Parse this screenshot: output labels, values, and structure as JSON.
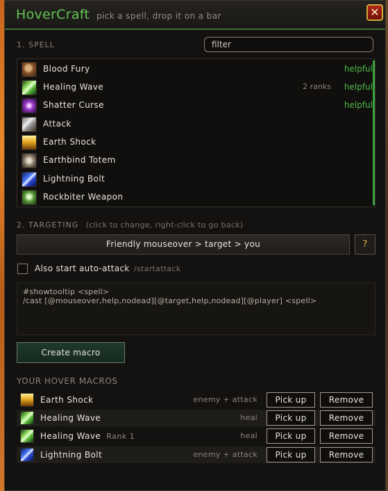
{
  "window": {
    "title": "HoverCraft",
    "subtitle": "pick a spell, drop it on a bar",
    "close_label": "✕"
  },
  "spell_section": {
    "label": "1. SPELL",
    "filter_placeholder": "filter",
    "spells": [
      {
        "name": "Blood Fury",
        "rank": "",
        "tag": "helpful",
        "icon": "blood-fury-icon"
      },
      {
        "name": "Healing Wave",
        "rank": "2 ranks",
        "tag": "helpful",
        "icon": "healing-wave-icon"
      },
      {
        "name": "Shatter Curse",
        "rank": "",
        "tag": "helpful",
        "icon": "shatter-curse-icon"
      },
      {
        "name": "Attack",
        "rank": "",
        "tag": "",
        "icon": "attack-icon"
      },
      {
        "name": "Earth Shock",
        "rank": "",
        "tag": "",
        "icon": "earth-shock-icon"
      },
      {
        "name": "Earthbind Totem",
        "rank": "",
        "tag": "",
        "icon": "earthbind-totem-icon"
      },
      {
        "name": "Lightning Bolt",
        "rank": "",
        "tag": "",
        "icon": "lightning-bolt-icon"
      },
      {
        "name": "Rockbiter Weapon",
        "rank": "",
        "tag": "",
        "icon": "rockbiter-weapon-icon"
      }
    ]
  },
  "targeting": {
    "label": "2. TARGETING",
    "hint": "(click to change, right-click to go back)",
    "button_label": "Friendly mouseover > target > you",
    "help_label": "?"
  },
  "auto_attack": {
    "label": "Also start auto-attack",
    "hint": "/startattack",
    "checked": false
  },
  "macro_text": {
    "line1": "#showtooltip <spell>",
    "line2": "/cast [@mouseover,help,nodead][@target,help,nodead][@player] <spell>"
  },
  "create_button_label": "Create macro",
  "hover_macros": {
    "heading": "YOUR HOVER MACROS",
    "pick_label": "Pick up",
    "remove_label": "Remove",
    "items": [
      {
        "name": "Earth Shock",
        "rank": "",
        "desc": "enemy + attack",
        "icon": "earth-shock-icon"
      },
      {
        "name": "Healing Wave",
        "rank": "",
        "desc": "heal",
        "icon": "healing-wave-icon"
      },
      {
        "name": "Healing Wave",
        "rank": "Rank 1",
        "desc": "heal",
        "icon": "healing-wave-icon"
      },
      {
        "name": "Lightning Bolt",
        "rank": "",
        "desc": "enemy + attack",
        "icon": "lightning-bolt-icon"
      }
    ]
  },
  "colors": {
    "title_green": "#62c556",
    "helpful_green": "#4fb84a",
    "help_gold": "#e2b33a"
  }
}
